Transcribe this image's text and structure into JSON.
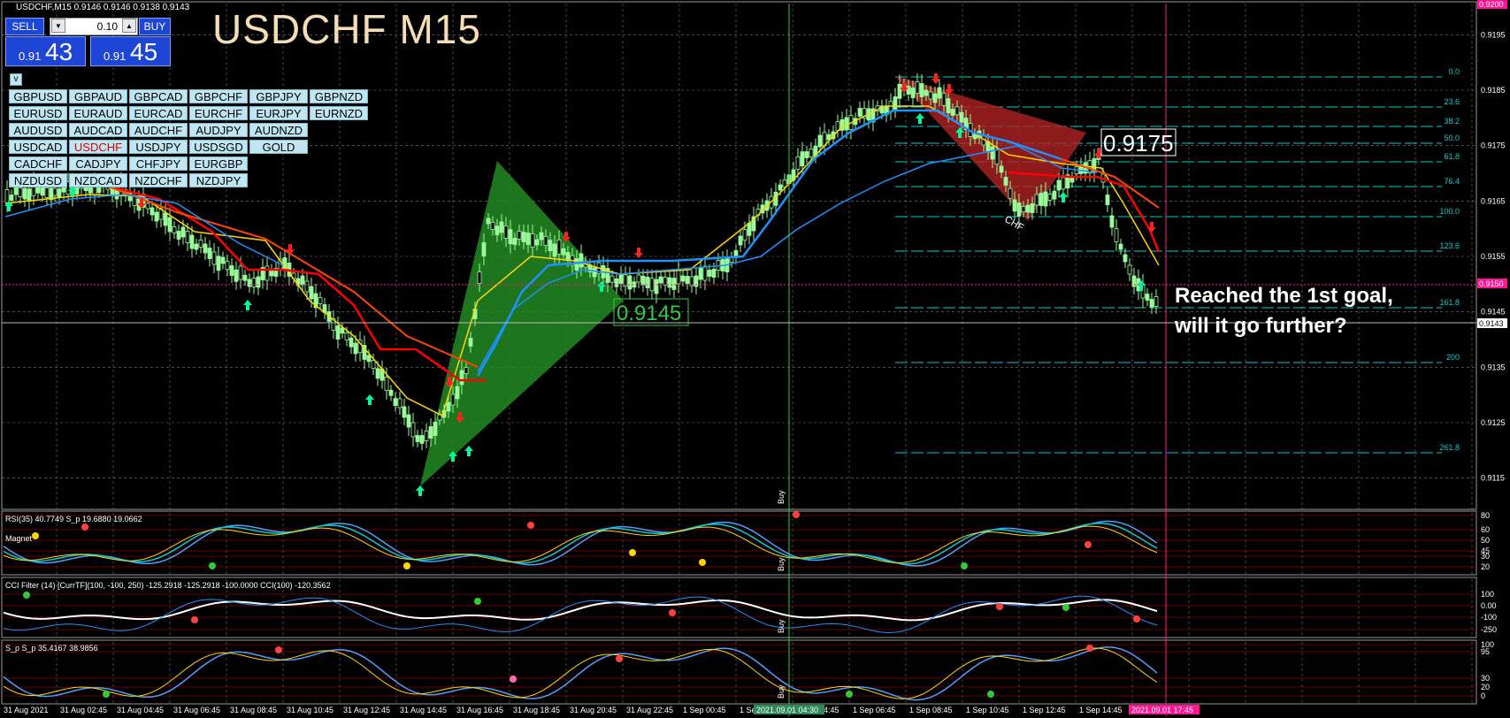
{
  "header": {
    "symbol_line": "USDCHF,M15  0.9146 0.9146 0.9138 0.9143",
    "big_title": "USDCHF M15"
  },
  "trade_panel": {
    "sell_label": "SELL",
    "buy_label": "BUY",
    "lot_value": "0.10",
    "sell_price_small": "0.91",
    "sell_price_big": "43",
    "buy_price_small": "0.91",
    "buy_price_big": "45"
  },
  "toggle_label": "v",
  "pairs": [
    [
      "GBPUSD",
      "GBPAUD",
      "GBPCAD",
      "GBPCHF",
      "GBPJPY",
      "GBPNZD"
    ],
    [
      "EURUSD",
      "EURAUD",
      "EURCAD",
      "EURCHF",
      "EURJPY",
      "EURNZD"
    ],
    [
      "AUDUSD",
      "AUDCAD",
      "AUDCHF",
      "AUDJPY",
      "AUDNZD"
    ],
    [
      "USDCAD",
      "USDCHF",
      "USDJPY",
      "USDSGD",
      "GOLD"
    ],
    [
      "CADCHF",
      "CADJPY",
      "CHFJPY",
      "EURGBP"
    ],
    [
      "NZDUSD",
      "NZDCAD",
      "NZDCHF",
      "NZDJPY"
    ]
  ],
  "active_pair": "USDCHF",
  "annotations": {
    "label_low": "0.9145",
    "label_high": "0.9175",
    "note_line1": "Reached the 1st goal,",
    "note_line2": "will it go further?",
    "pattern_tag": "CHF"
  },
  "price_axis": [
    "0.9195",
    "0.9185",
    "0.9175",
    "0.9165",
    "0.9155",
    "0.9145",
    "0.9135",
    "0.9125",
    "0.9115"
  ],
  "price_tags": {
    "top": "0.9200",
    "pink": "0.9150",
    "current": "0.9143"
  },
  "fibo_levels": [
    "0.0",
    "23.6",
    "38.2",
    "50.0",
    "61.8",
    "76.4",
    "100.0",
    "123.6",
    "161.8",
    "200",
    "261.8"
  ],
  "time_axis": [
    "31 Aug 2021",
    "31 Aug 02:45",
    "31 Aug 04:45",
    "31 Aug 06:45",
    "31 Aug 08:45",
    "31 Aug 10:45",
    "31 Aug 12:45",
    "31 Aug 14:45",
    "31 Aug 16:45",
    "31 Aug 18:45",
    "31 Aug 20:45",
    "31 Aug 22:45",
    "1 Sep 00:45",
    "1 Sep 02:45",
    "1 Sep 04:45",
    "1 Sep 06:45",
    "1 Sep 08:45",
    "1 Sep 10:45",
    "1 Sep 12:45",
    "1 Sep 14:45"
  ],
  "time_tags": {
    "green": "2021.09.01 04:30",
    "pink": "2021.09.01 17:45"
  },
  "buy_marker": "Buy",
  "indicators": {
    "rsi": {
      "label": "RSI(35) 40.7749  S_p 19.6880 19.0662",
      "sub": "Magnet",
      "levels": [
        "80",
        "60",
        "50",
        "45",
        "30",
        "20"
      ]
    },
    "cci": {
      "label": "CCI Filter (14) [CurrTF](100, -100, 250) -125.2918 -125.2918 -100.0000  CCI(100) -120.3562",
      "levels": [
        "100",
        "0.00",
        "-100",
        "-250"
      ]
    },
    "stoch": {
      "label": "S_p  S_p 35.4167 38.9856",
      "levels": [
        "100",
        "95",
        "30",
        "20",
        "0"
      ]
    }
  },
  "colors": {
    "background": "#000000",
    "grid": "#c8c8c8",
    "candle": "#98fb98",
    "ma_yellow": "#ffd700",
    "ma_red": "#ff0000",
    "ma_orange": "#ff4500",
    "ma_blue": "#1e90ff",
    "fibo": "#00ced1",
    "green_pattern": "#228b22",
    "red_pattern": "#b22222",
    "arrow_up": "#00fa9a",
    "arrow_down": "#ff2020",
    "vline_green": "#32cd32",
    "vline_pink": "#ff1493"
  }
}
